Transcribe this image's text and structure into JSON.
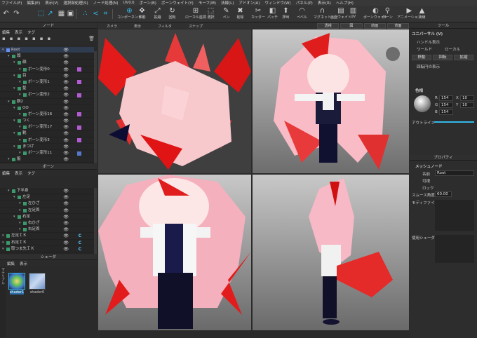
{
  "menu": [
    "ファイル(F)",
    "編集(E)",
    "表示(V)",
    "選択部処理(S)",
    "ノード処理(N)",
    "UV(U)",
    "ボーン(B)",
    "ボーンウェイト(Y)",
    "モーフ(M)",
    "法線(L)",
    "アドオン(A)",
    "ウィンドウ(W)",
    "パネル(P)",
    "表示(R)",
    "ヘルプ(H)"
  ],
  "toolbar": {
    "tools": [
      "コンポーネント",
      "移動",
      "拡縮",
      "回転",
      "ローカル座標",
      "選択",
      "ペン",
      "削除",
      "カッター",
      "パッチ",
      "押出",
      "ペベル",
      "マグネット",
      "画面ウェイト",
      "UV",
      "ボーンウェイト",
      "ボーン",
      "アニメーション",
      "法線"
    ],
    "label_right": "ツール"
  },
  "node_panel": {
    "title": "ノード",
    "tabs": [
      "編集",
      "表示",
      "タグ"
    ],
    "rows": [
      {
        "label": "Root",
        "indent": 0,
        "color": "#6a8ff0",
        "swatch": "#5b8fd1"
      },
      {
        "label": "頭",
        "indent": 1
      },
      {
        "label": "顔",
        "indent": 2
      },
      {
        "label": "ボーン変形0",
        "indent": 3,
        "mark": "#b45bd6"
      },
      {
        "label": "目",
        "indent": 2
      },
      {
        "label": "ボーン変形1",
        "indent": 3,
        "mark": "#b45bd6"
      },
      {
        "label": "髪",
        "indent": 2
      },
      {
        "label": "ボーン変形2",
        "indent": 3,
        "mark": "#b45bd6"
      },
      {
        "label": "胴2",
        "indent": 1
      },
      {
        "label": "OO",
        "indent": 2
      },
      {
        "label": "ボーン変形16",
        "indent": 3,
        "mark": "#b45bd6"
      },
      {
        "label": "つく",
        "indent": 2
      },
      {
        "label": "ボーン変形17",
        "indent": 3,
        "mark": "#b45bd6"
      },
      {
        "label": "靴",
        "indent": 2
      },
      {
        "label": "ボーン変形3",
        "indent": 3,
        "mark": "#b45bd6"
      },
      {
        "label": "まつげ",
        "indent": 2
      },
      {
        "label": "ボーン変形11",
        "indent": 3,
        "mark": "#5577cc"
      },
      {
        "label": "服",
        "indent": 1
      }
    ]
  },
  "bone_panel": {
    "title": "ボーン",
    "tabs": [
      "編集",
      "表示",
      "タグ"
    ],
    "rows": [
      {
        "label": "下半身",
        "indent": 1
      },
      {
        "label": "左足",
        "indent": 2
      },
      {
        "label": "左ひざ",
        "indent": 3
      },
      {
        "label": "左足首",
        "indent": 3
      },
      {
        "label": "右足",
        "indent": 2
      },
      {
        "label": "右ひざ",
        "indent": 3
      },
      {
        "label": "右足首",
        "indent": 3
      },
      {
        "label": "左足ＩＫ",
        "indent": 0,
        "c": true
      },
      {
        "label": "右足ＩＫ",
        "indent": 0,
        "c": true
      },
      {
        "label": "取つま先ＩＫ",
        "indent": 0,
        "c": true
      }
    ]
  },
  "shader_panel": {
    "title": "シェーダ",
    "tabs": [
      "編集",
      "表示"
    ],
    "side_label": "マテリアル",
    "items": [
      {
        "label": "shader1",
        "selected": true
      },
      {
        "label": "shader0",
        "selected": false
      }
    ]
  },
  "viewport_bar": [
    "カメラ",
    "表示",
    "フィルタ",
    "スナップ"
  ],
  "view_buttons": [
    "透視",
    "図",
    "前面",
    "背面"
  ],
  "right_panel": {
    "universal": {
      "title": "ユニバーサル (V)",
      "handle": "ハンドル表示",
      "world": "ワールド",
      "local": "ローカル",
      "move": "移動",
      "rotate": "回転",
      "scale": "拡縮",
      "rotation_display": "回転円の表示"
    },
    "color": {
      "title": "色相",
      "r_label": "R",
      "g_label": "G",
      "b_label": "B",
      "r": "154",
      "g": "154",
      "b": "154",
      "x_label": "X",
      "y_label": "Y",
      "x": "10",
      "y": "10",
      "outline": "アウトライン"
    },
    "props": {
      "title": "プロパティ",
      "node": "メッシュノード",
      "name_label": "名前",
      "name": "Root",
      "visible_label": "可視",
      "lock_label": "ロック",
      "smooth_label": "スムース角度",
      "smooth_value": "60.00",
      "modifier_label": "モディファイア",
      "used_label": "使用シェーダ"
    }
  },
  "colors": {
    "accent": "#35b8e8",
    "bg": "#2b2b2b",
    "viewport_dark": "#3d3d3d",
    "viewport_light": "#c8c8c8"
  }
}
